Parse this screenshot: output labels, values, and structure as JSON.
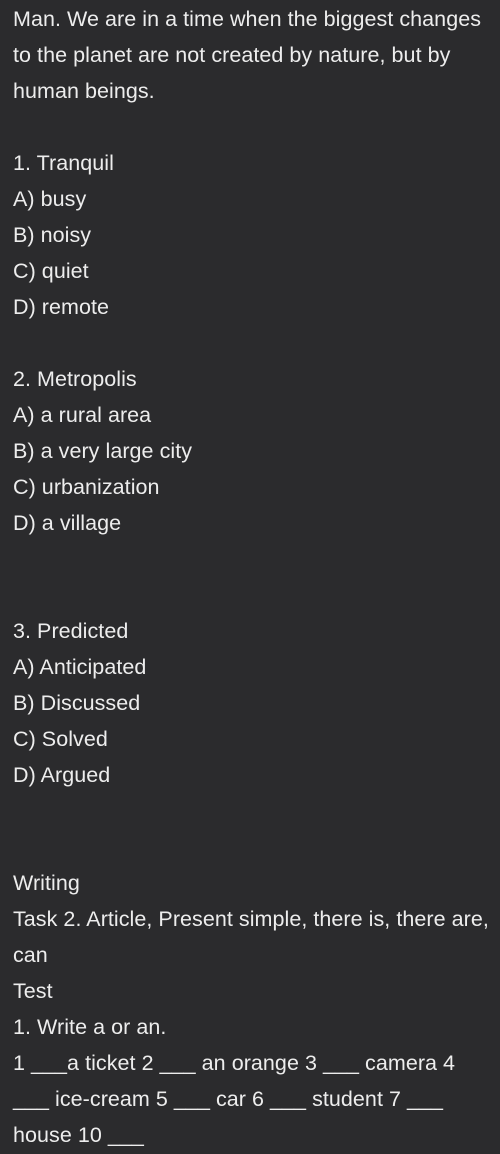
{
  "page": {
    "background_color": "#2b2b2d",
    "text_color": "#ededed"
  },
  "intro": {
    "text": "Man. We are in a time when the biggest changes to the planet are not created by nature, but by human beings."
  },
  "vocabulary": {
    "questions": [
      {
        "prompt": "1. Tranquil",
        "options": [
          "A) busy",
          "B) noisy",
          "C) quiet",
          "D) remote"
        ]
      },
      {
        "prompt": "2. Metropolis",
        "options": [
          "A) a rural area",
          "B) a very large city",
          "C) urbanization",
          "D) a village"
        ]
      },
      {
        "prompt": "3. Predicted",
        "options": [
          "A) Anticipated",
          "B) Discussed",
          "C) Solved",
          "D) Argued"
        ]
      }
    ]
  },
  "writing": {
    "heading": "Writing",
    "task_title": "Task 2. Article, Present simple, there is, there are, can",
    "test_label": "Test",
    "exercise": {
      "instruction": "1. Write a or an.",
      "items_text": "1 ___a ticket 2 ___ an orange 3 ___ camera 4 ___ ice-cream 5 ___ car 6 ___ student 7 ___ house 10 ___",
      "items": [
        "1 ___a ticket",
        "2 ___ an orange",
        "3 ___ camera",
        "4 ___ ice-cream",
        "5 ___ car",
        "6 ___ student",
        "7 ___ house",
        "10 ___"
      ]
    }
  }
}
